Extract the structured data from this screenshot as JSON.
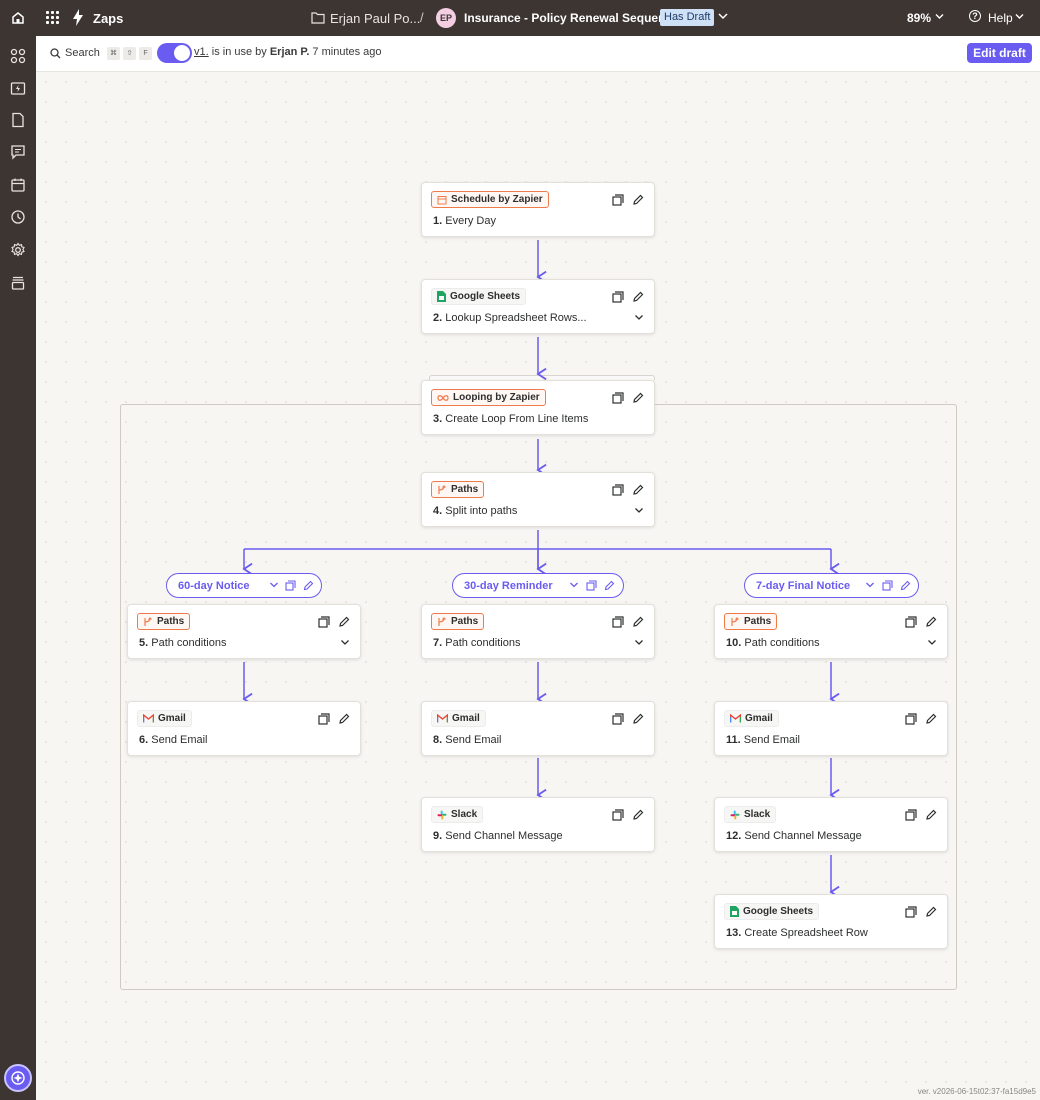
{
  "topbar": {
    "section": "Zaps",
    "folder": "Erjan Paul Po...",
    "separator": "/",
    "avatar_initials": "EP",
    "zap_name": "Insurance - Policy Renewal Sequence",
    "draft_badge": "Has Draft",
    "zoom": "89%",
    "help": "Help"
  },
  "subbar": {
    "search_label": "Search",
    "shortcut_keys": [
      "⌘",
      "⇧",
      "F"
    ],
    "version_link": "v1.",
    "status_mid": " is in use by ",
    "user": "Erjan P.",
    "time": " 7 minutes ago",
    "edit_button": "Edit draft"
  },
  "steps": {
    "s1": {
      "app": "Schedule by Zapier",
      "num": "1.",
      "title": "Every Day",
      "icon": "calendar-icon"
    },
    "s2": {
      "app": "Google Sheets",
      "num": "2.",
      "title": "Lookup Spreadsheet Rows...",
      "icon": "google-sheets-icon"
    },
    "s3": {
      "app": "Looping by Zapier",
      "num": "3.",
      "title": "Create Loop From Line Items",
      "icon": "loop-icon"
    },
    "s4": {
      "app": "Paths",
      "num": "4.",
      "title": "Split into paths",
      "icon": "paths-icon"
    },
    "s5": {
      "app": "Paths",
      "num": "5.",
      "title": "Path conditions",
      "icon": "paths-icon"
    },
    "s6": {
      "app": "Gmail",
      "num": "6.",
      "title": "Send Email",
      "icon": "gmail-icon"
    },
    "s7": {
      "app": "Paths",
      "num": "7.",
      "title": "Path conditions",
      "icon": "paths-icon"
    },
    "s8": {
      "app": "Gmail",
      "num": "8.",
      "title": "Send Email",
      "icon": "gmail-icon"
    },
    "s9": {
      "app": "Slack",
      "num": "9.",
      "title": "Send Channel Message",
      "icon": "slack-icon"
    },
    "s10": {
      "app": "Paths",
      "num": "10.",
      "title": "Path conditions",
      "icon": "paths-icon"
    },
    "s11": {
      "app": "Gmail",
      "num": "11.",
      "title": "Send Email",
      "icon": "gmail-icon"
    },
    "s12": {
      "app": "Slack",
      "num": "12.",
      "title": "Send Channel Message",
      "icon": "slack-icon"
    },
    "s13": {
      "app": "Google Sheets",
      "num": "13.",
      "title": "Create Spreadsheet Row",
      "icon": "google-sheets-icon"
    }
  },
  "paths": {
    "p1": "60-day Notice",
    "p2": "30-day Reminder",
    "p3": "7-day Final Notice"
  },
  "footer": {
    "version": "ver. v2026-06-15t02:37-fa15d9e5"
  },
  "colors": {
    "accent": "#6a5cf0",
    "chrome": "#3d3532",
    "orange": "#f07b4a",
    "draft_badge": "#cfe1f7"
  }
}
